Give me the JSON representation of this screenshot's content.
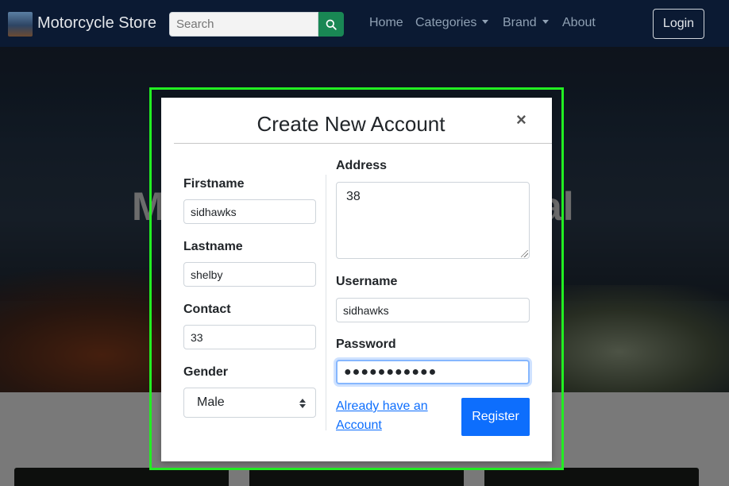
{
  "navbar": {
    "brand": "Motorcycle Store",
    "search_placeholder": "Search",
    "links": [
      "Home",
      "Categories",
      "Brand",
      "About"
    ],
    "login": "Login"
  },
  "hero": {
    "title_left": "M",
    "title_right": "al"
  },
  "modal": {
    "title": "Create New Account",
    "close": "×",
    "fields": {
      "firstname": {
        "label": "Firstname",
        "value": "sidhawks"
      },
      "lastname": {
        "label": "Lastname",
        "value": "shelby"
      },
      "contact": {
        "label": "Contact",
        "value": "33"
      },
      "gender": {
        "label": "Gender",
        "value": "Male"
      },
      "address": {
        "label": "Address",
        "value": "38"
      },
      "username": {
        "label": "Username",
        "value": "sidhawks"
      },
      "password": {
        "label": "Password",
        "value": "●●●●●●●●●●●"
      }
    },
    "login_link": "Already have an Account",
    "register": "Register"
  },
  "colors": {
    "accent": "#0d6efd",
    "search_button": "#198754",
    "focus_outline": "#22ee22",
    "navbar": "#0b1a33"
  },
  "icons": {
    "search": "search-icon",
    "close": "close-icon",
    "select": "select-arrows-icon"
  }
}
